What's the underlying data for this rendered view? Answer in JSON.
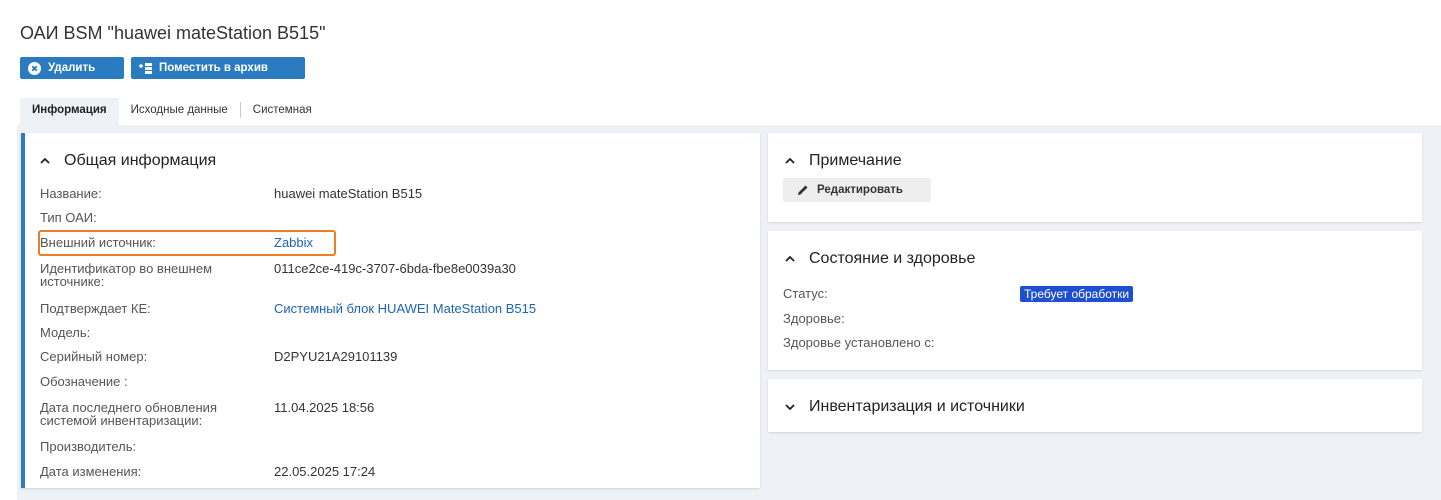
{
  "page": {
    "title": "ОАИ BSM \"huawei mateStation B515\""
  },
  "toolbar": {
    "delete_label": "Удалить",
    "archive_label": "Поместить в архив"
  },
  "tabs": [
    {
      "label": "Информация",
      "active": true
    },
    {
      "label": "Исходные данные",
      "active": false
    },
    {
      "label": "Системная",
      "active": false
    }
  ],
  "general": {
    "title": "Общая информация",
    "fields": [
      {
        "label": "Название:",
        "value": "huawei mateStation B515"
      },
      {
        "label": "Тип ОАИ:",
        "value": ""
      },
      {
        "label": "Внешний источник:",
        "value": "Zabbix"
      },
      {
        "label": "Идентификатор во внешнем источнике:",
        "value": "011ce2ce-419c-3707-6bda-fbe8e0039a30"
      },
      {
        "label": "Подтверждает КЕ:",
        "value": "Системный блок HUAWEI MateStation B515"
      },
      {
        "label": "Модель:",
        "value": ""
      },
      {
        "label": "Серийный номер:",
        "value": "D2PYU21A29101139"
      },
      {
        "label": "Обозначение :",
        "value": ""
      },
      {
        "label": "Дата последнего обновления системой инвентаризации:",
        "value": "11.04.2025 18:56"
      },
      {
        "label": "Производитель:",
        "value": ""
      },
      {
        "label": "Дата изменения:",
        "value": "22.05.2025 17:24"
      }
    ]
  },
  "note": {
    "title": "Примечание",
    "edit_label": "Редактировать"
  },
  "state": {
    "title": "Состояние и здоровье",
    "status_label": "Статус:",
    "status_value": "Требует обработки",
    "health_label": "Здоровье:",
    "health_since_label": "Здоровье установлено с:"
  },
  "inventory": {
    "title": "Инвентаризация и источники"
  },
  "colors": {
    "accent": "#2b7bc0",
    "highlight": "#f07c24",
    "badge": "#1f4fd1",
    "link": "#1e64b4"
  }
}
